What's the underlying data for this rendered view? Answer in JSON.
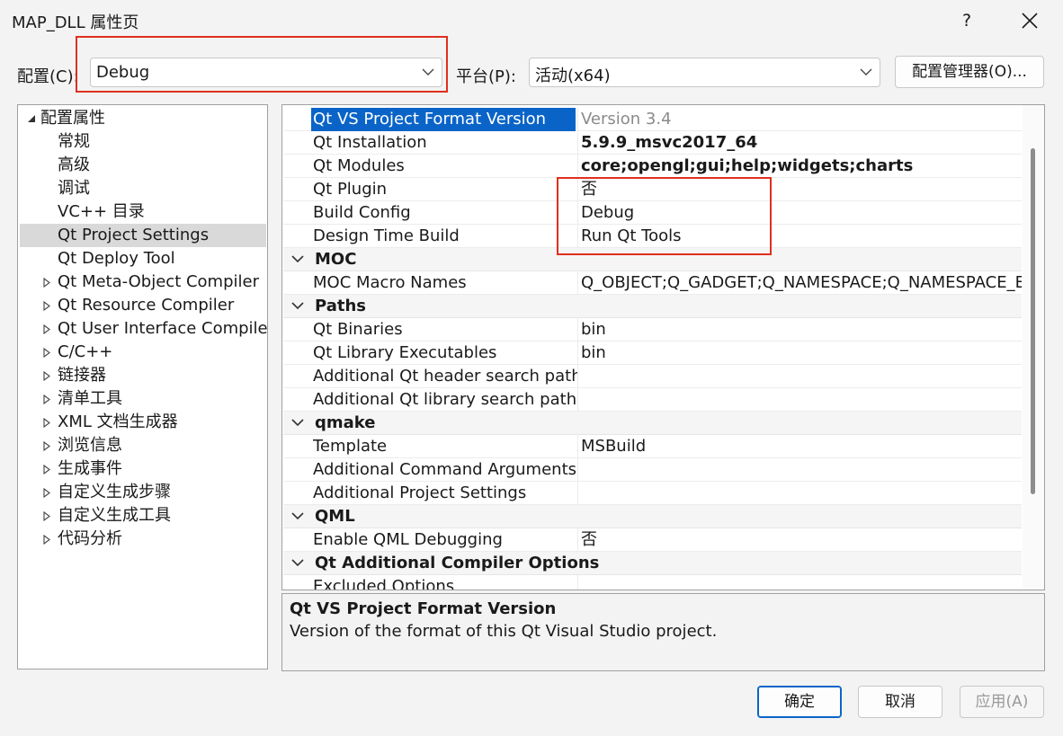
{
  "window": {
    "title": "MAP_DLL 属性页",
    "help_label": "?"
  },
  "config": {
    "label": "配置(C):",
    "value": "Debug"
  },
  "platform": {
    "label": "平台(P):",
    "value": "活动(x64)"
  },
  "config_manager_label": "配置管理器(O)...",
  "tree": {
    "root": "配置属性",
    "items": [
      {
        "label": "常规",
        "expandable": false
      },
      {
        "label": "高级",
        "expandable": false
      },
      {
        "label": "调试",
        "expandable": false
      },
      {
        "label": "VC++ 目录",
        "expandable": false
      },
      {
        "label": "Qt Project Settings",
        "expandable": false,
        "selected": true
      },
      {
        "label": "Qt Deploy Tool",
        "expandable": false
      },
      {
        "label": "Qt Meta-Object Compiler",
        "expandable": true
      },
      {
        "label": "Qt Resource Compiler",
        "expandable": true
      },
      {
        "label": "Qt User Interface Compiler",
        "expandable": true
      },
      {
        "label": "C/C++",
        "expandable": true
      },
      {
        "label": "链接器",
        "expandable": true
      },
      {
        "label": "清单工具",
        "expandable": true
      },
      {
        "label": "XML 文档生成器",
        "expandable": true
      },
      {
        "label": "浏览信息",
        "expandable": true
      },
      {
        "label": "生成事件",
        "expandable": true
      },
      {
        "label": "自定义生成步骤",
        "expandable": true
      },
      {
        "label": "自定义生成工具",
        "expandable": true
      },
      {
        "label": "代码分析",
        "expandable": true
      }
    ]
  },
  "grid": {
    "rows": [
      {
        "type": "prop",
        "name": "Qt VS Project Format Version",
        "value": "Version 3.4",
        "style": "gray",
        "selected": true
      },
      {
        "type": "prop",
        "name": "Qt Installation",
        "value": "5.9.9_msvc2017_64",
        "style": "bold"
      },
      {
        "type": "prop",
        "name": "Qt Modules",
        "value": "core;opengl;gui;help;widgets;charts",
        "style": "bold"
      },
      {
        "type": "prop",
        "name": "Qt Plugin",
        "value": "否"
      },
      {
        "type": "prop",
        "name": "Build Config",
        "value": "Debug"
      },
      {
        "type": "prop",
        "name": "Design Time Build",
        "value": "Run Qt Tools"
      },
      {
        "type": "cat",
        "name": "MOC"
      },
      {
        "type": "prop",
        "name": "MOC Macro Names",
        "value": "Q_OBJECT;Q_GADGET;Q_NAMESPACE;Q_NAMESPACE_EX"
      },
      {
        "type": "cat",
        "name": "Paths"
      },
      {
        "type": "prop",
        "name": "Qt Binaries",
        "value": "bin"
      },
      {
        "type": "prop",
        "name": "Qt Library Executables",
        "value": "bin"
      },
      {
        "type": "prop",
        "name": "Additional Qt header search paths",
        "value": ""
      },
      {
        "type": "prop",
        "name": "Additional Qt library search paths",
        "value": ""
      },
      {
        "type": "cat",
        "name": "qmake"
      },
      {
        "type": "prop",
        "name": "Template",
        "value": "MSBuild"
      },
      {
        "type": "prop",
        "name": "Additional Command Arguments",
        "value": ""
      },
      {
        "type": "prop",
        "name": "Additional Project Settings",
        "value": ""
      },
      {
        "type": "cat",
        "name": "QML"
      },
      {
        "type": "prop",
        "name": "Enable QML Debugging",
        "value": "否"
      },
      {
        "type": "cat",
        "name": "Qt Additional Compiler Options"
      },
      {
        "type": "prop",
        "name": "Excluded Options",
        "value": ""
      }
    ]
  },
  "description": {
    "title": "Qt VS Project Format Version",
    "text": "Version of the format of this Qt Visual Studio project."
  },
  "buttons": {
    "ok": "确定",
    "cancel": "取消",
    "apply": "应用(A)"
  },
  "colors": {
    "selection": "#0a64c8",
    "annotation": "#e0301e"
  }
}
